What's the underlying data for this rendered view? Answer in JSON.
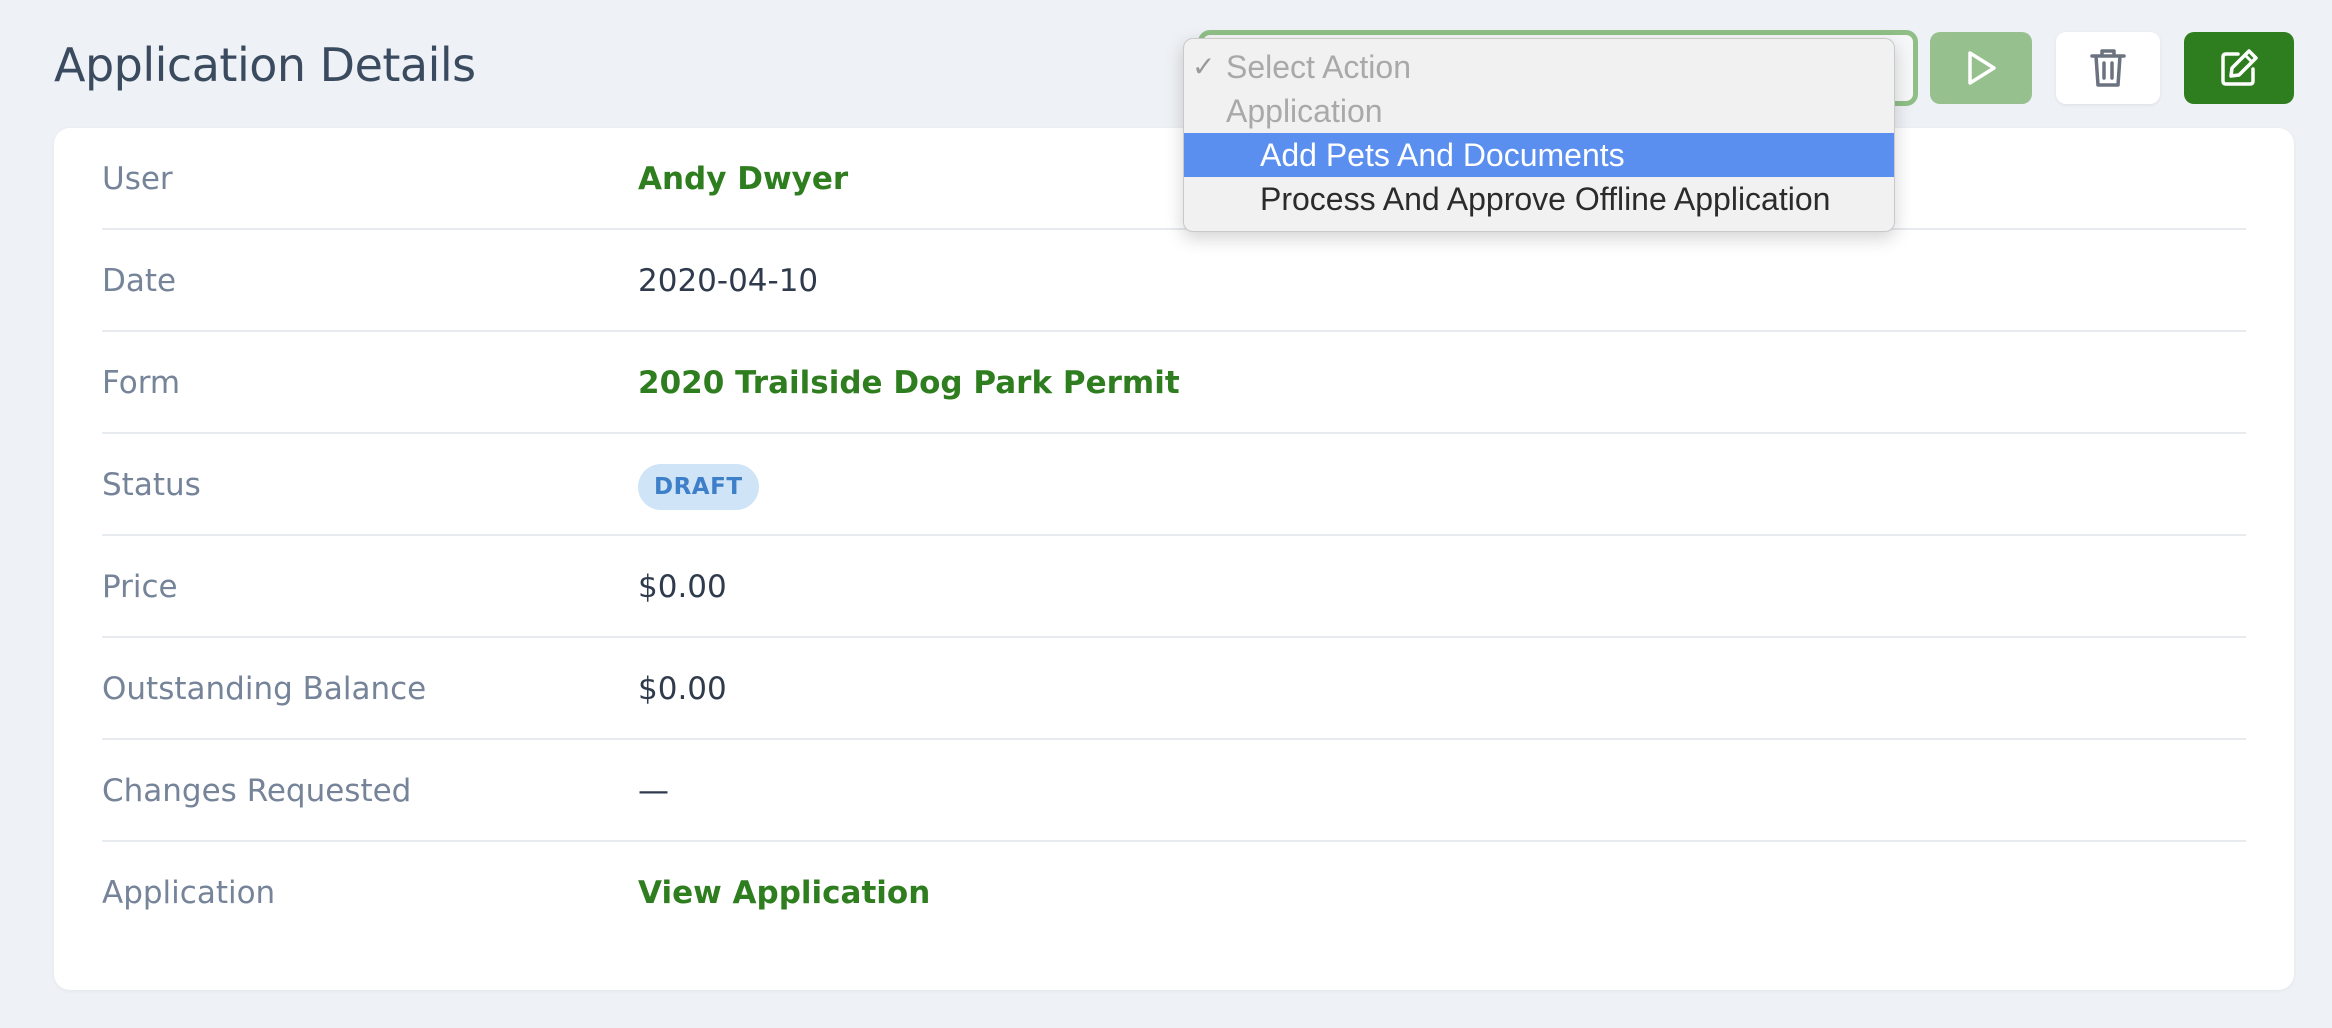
{
  "header": {
    "title": "Application Details"
  },
  "toolbar": {
    "select_placeholder": "Select Action",
    "run_icon": "play-icon",
    "delete_icon": "trash-icon",
    "edit_icon": "edit-icon"
  },
  "dropdown": {
    "placeholder": "Select Action",
    "group_label": "Application",
    "options": [
      {
        "label": "Add Pets And Documents",
        "selected": true
      },
      {
        "label": "Process And Approve Offline Application",
        "selected": false
      }
    ]
  },
  "details": {
    "user": {
      "label": "User",
      "value": "Andy Dwyer"
    },
    "date": {
      "label": "Date",
      "value": "2020-04-10"
    },
    "form": {
      "label": "Form",
      "value": "2020 Trailside Dog Park Permit"
    },
    "status": {
      "label": "Status",
      "value": "DRAFT"
    },
    "price": {
      "label": "Price",
      "value": "$0.00"
    },
    "balance": {
      "label": "Outstanding Balance",
      "value": "$0.00"
    },
    "changes": {
      "label": "Changes Requested",
      "value": "—"
    },
    "application": {
      "label": "Application",
      "value": "View Application"
    }
  },
  "colors": {
    "accent_green": "#2e7d1f",
    "badge_bg": "#cfe4f7",
    "badge_text": "#3d7fc9",
    "selected_option": "#5a8fef"
  }
}
